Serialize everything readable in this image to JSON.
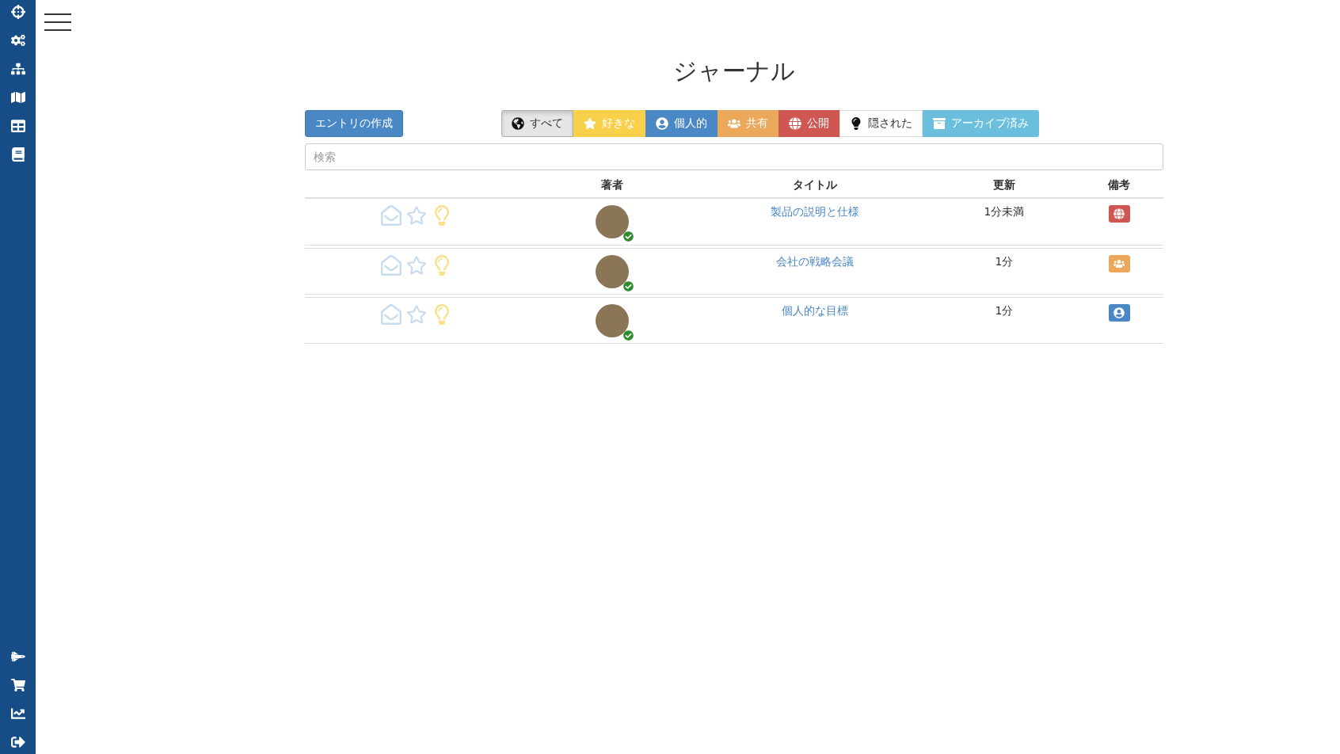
{
  "title": "ジャーナル",
  "create_button": "エントリの作成",
  "filters": [
    {
      "kind": "all",
      "label": "すべて",
      "selected": true
    },
    {
      "kind": "favorite",
      "label": "好きな",
      "selected": false
    },
    {
      "kind": "personal",
      "label": "個人的",
      "selected": false
    },
    {
      "kind": "shared",
      "label": "共有",
      "selected": false
    },
    {
      "kind": "public",
      "label": "公開",
      "selected": false
    },
    {
      "kind": "hidden",
      "label": "隠された",
      "selected": false
    },
    {
      "kind": "archived",
      "label": "アーカイブ済み",
      "selected": false
    }
  ],
  "search": {
    "placeholder": "検索"
  },
  "table": {
    "columns": [
      "著者",
      "タイトル",
      "更新",
      "備考"
    ],
    "rows": [
      {
        "title": "製品の説明と仕様",
        "updated": "1分未満",
        "kind": "public"
      },
      {
        "title": "会社の戦略会議",
        "updated": "1分",
        "kind": "shared"
      },
      {
        "title": "個人的な目標",
        "updated": "1分",
        "kind": "personal"
      }
    ]
  }
}
